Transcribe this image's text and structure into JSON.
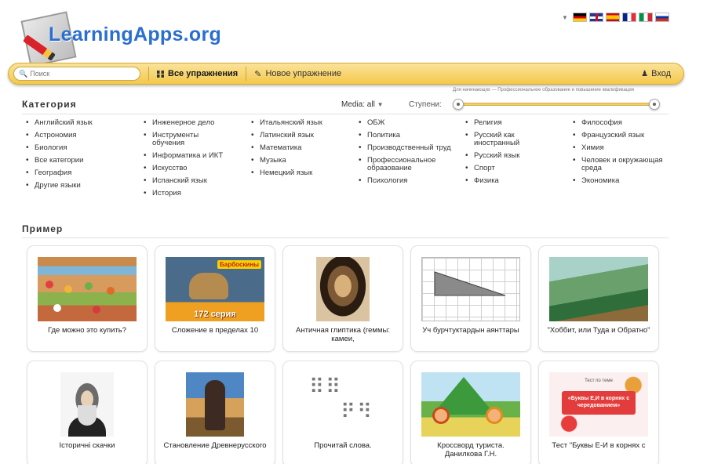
{
  "app": {
    "logo_text": "LearningApps.org"
  },
  "languages": [
    "de",
    "en",
    "es",
    "fr",
    "it",
    "ru"
  ],
  "nav": {
    "search_placeholder": "Поиск",
    "all_exercises": "Все упражнения",
    "new_exercise": "Новое упражнение",
    "login": "Вход"
  },
  "filters": {
    "category_title": "Категория",
    "media_label": "Media: all",
    "levels_label": "Ступени:",
    "levels_caption": "Для начинающих — Профессиональное образование и повышение квалификации"
  },
  "categories": [
    [
      "Английский язык",
      "Астрономия",
      "Биология",
      "Все категории",
      "География",
      "Другие языки"
    ],
    [
      "Инженерное дело",
      "Инструменты обучения",
      "Информатика и ИКТ",
      "Искусство",
      "Испанский язык",
      "История"
    ],
    [
      "Итальянский язык",
      "Латинский язык",
      "Математика",
      "Музыка",
      "Немецкий язык"
    ],
    [
      "ОБЖ",
      "Политика",
      "Производственный труд",
      "Профессиональное образование",
      "Психология"
    ],
    [
      "Религия",
      "Русский как иностранный",
      "Русский язык",
      "Спорт",
      "Физика"
    ],
    [
      "Философия",
      "Французский язык",
      "Химия",
      "Человек и окружающая среда",
      "Экономика"
    ]
  ],
  "examples_title": "Пример",
  "examples": [
    {
      "title": "Где можно это купить?",
      "thumb": "market"
    },
    {
      "title": "Сложение в пределах 10",
      "thumb": "video",
      "thumb_text": "172 серия",
      "thumb_title": "Барбоскины"
    },
    {
      "title": "Античная глиптика (геммы: камеи,",
      "thumb": "gem"
    },
    {
      "title": "Уч бурчтуктардын аянттары",
      "thumb": "grid"
    },
    {
      "title": "\"Хоббит, или Туда и Обратно\"",
      "thumb": "forest"
    },
    {
      "title": "Історичні скачки",
      "thumb": "portrait"
    },
    {
      "title": "Становление Древнерусского",
      "thumb": "painting"
    },
    {
      "title": "Прочитай слова.",
      "thumb": "letters"
    },
    {
      "title": "Кроссворд туриста. Данилкова Г.Н.",
      "thumb": "cartoon"
    },
    {
      "title": "Тест \"Буквы Е-И в корнях с",
      "thumb": "test",
      "thumb_small": "Тест по теме",
      "thumb_text": "«Буквы Е,И в корнях с чередованием»"
    }
  ]
}
